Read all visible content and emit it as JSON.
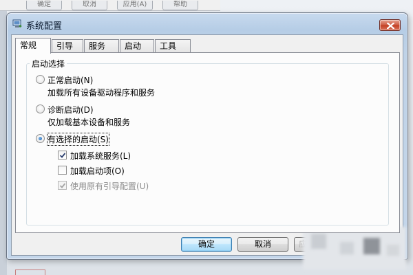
{
  "background": {
    "toolbar_buttons": [
      "确定",
      "取消",
      "应用(A)",
      "帮助"
    ]
  },
  "dialog": {
    "title": "系统配置",
    "icon": "system-config-icon",
    "close_icon": "close-icon"
  },
  "tabs": [
    {
      "label": "常规",
      "active": true
    },
    {
      "label": "引导",
      "active": false
    },
    {
      "label": "服务",
      "active": false
    },
    {
      "label": "启动",
      "active": false
    },
    {
      "label": "工具",
      "active": false
    }
  ],
  "startup_selection": {
    "group_title": "启动选择",
    "options": [
      {
        "label": "正常启动(N)",
        "description": "加载所有设备驱动程序和服务",
        "selected": false
      },
      {
        "label": "诊断启动(D)",
        "description": "仅加载基本设备和服务",
        "selected": false
      },
      {
        "label": "有选择的启动(S)",
        "description": "",
        "selected": true
      }
    ],
    "selective_items": [
      {
        "label": "加载系统服务(L)",
        "checked": true,
        "enabled": true
      },
      {
        "label": "加载启动项(O)",
        "checked": false,
        "enabled": true
      },
      {
        "label": "使用原有引导配置(U)",
        "checked": true,
        "enabled": false
      }
    ]
  },
  "buttons": {
    "ok": "确定",
    "cancel": "取消",
    "apply_partial": "应"
  },
  "colors": {
    "default_button_border": "#3c7fb1",
    "radio_dot": "#1f5fa6",
    "close_button": "#c23e22"
  }
}
